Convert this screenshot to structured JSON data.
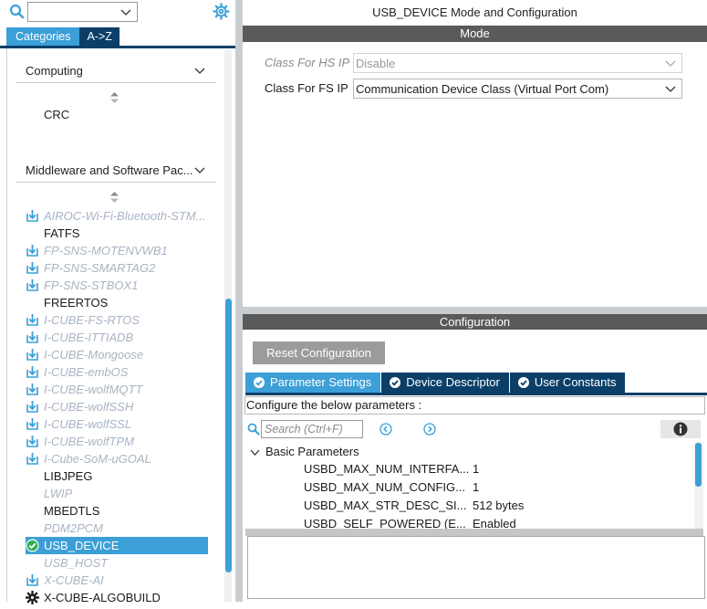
{
  "left": {
    "search_value": "",
    "tabs": [
      "Categories",
      "A->Z"
    ],
    "categories": [
      {
        "label": "Computing",
        "items": [
          "CRC"
        ]
      },
      {
        "label": "Middleware and Software Pac..."
      }
    ],
    "middleware_items": [
      {
        "label": "AIROC-Wi-Fi-Bluetooth-STM...",
        "state": "disabled",
        "icon": "download-icon"
      },
      {
        "label": "FATFS",
        "state": "normal",
        "icon": ""
      },
      {
        "label": "FP-SNS-MOTENVWB1",
        "state": "disabled",
        "icon": "download-icon"
      },
      {
        "label": "FP-SNS-SMARTAG2",
        "state": "disabled",
        "icon": "download-icon"
      },
      {
        "label": "FP-SNS-STBOX1",
        "state": "disabled",
        "icon": "download-icon"
      },
      {
        "label": "FREERTOS",
        "state": "normal",
        "icon": ""
      },
      {
        "label": "I-CUBE-FS-RTOS",
        "state": "disabled",
        "icon": "download-icon"
      },
      {
        "label": "I-CUBE-ITTIADB",
        "state": "disabled",
        "icon": "download-icon"
      },
      {
        "label": "I-CUBE-Mongoose",
        "state": "disabled",
        "icon": "download-icon"
      },
      {
        "label": "I-CUBE-embOS",
        "state": "disabled",
        "icon": "download-icon"
      },
      {
        "label": "I-CUBE-wolfMQTT",
        "state": "disabled",
        "icon": "download-icon"
      },
      {
        "label": "I-CUBE-wolfSSH",
        "state": "disabled",
        "icon": "download-icon"
      },
      {
        "label": "I-CUBE-wolfSSL",
        "state": "disabled",
        "icon": "download-icon"
      },
      {
        "label": "I-CUBE-wolfTPM",
        "state": "disabled",
        "icon": "download-icon"
      },
      {
        "label": "I-Cube-SoM-uGOAL",
        "state": "disabled",
        "icon": "download-icon"
      },
      {
        "label": "LIBJPEG",
        "state": "normal",
        "icon": ""
      },
      {
        "label": "LWIP",
        "state": "gray",
        "icon": ""
      },
      {
        "label": "MBEDTLS",
        "state": "normal",
        "icon": ""
      },
      {
        "label": "PDM2PCM",
        "state": "gray",
        "icon": ""
      },
      {
        "label": "USB_DEVICE",
        "state": "selected",
        "icon": "check-circle-icon"
      },
      {
        "label": "USB_HOST",
        "state": "gray",
        "icon": ""
      },
      {
        "label": "X-CUBE-AI",
        "state": "disabled",
        "icon": "download-icon"
      },
      {
        "label": "X-CUBE-ALGOBUILD",
        "state": "normal",
        "icon": "gear-icon"
      }
    ]
  },
  "right": {
    "title": "USB_DEVICE Mode and Configuration",
    "mode_header": "Mode",
    "mode_rows": [
      {
        "label": "Class For HS IP",
        "value": "Disable",
        "disabled": true
      },
      {
        "label": "Class For FS IP",
        "value": "Communication Device Class (Virtual Port Com)",
        "disabled": false
      }
    ],
    "config_header": "Configuration",
    "reset_label": "Reset Configuration",
    "config_tabs": [
      "Parameter Settings",
      "Device Descriptor",
      "User Constants"
    ],
    "configure_label": "Configure the below parameters :",
    "search_placeholder": "Search (Ctrl+F)",
    "group_label": "Basic Parameters",
    "params": [
      {
        "name": "USBD_MAX_NUM_INTERFA...",
        "value": "1"
      },
      {
        "name": "USBD_MAX_NUM_CONFIG...",
        "value": "1"
      },
      {
        "name": "USBD_MAX_STR_DESC_SI...",
        "value": "512 bytes"
      },
      {
        "name": "USBD_SELF_POWERED (E...",
        "value": "Enabled"
      }
    ]
  },
  "colors": {
    "accent": "#3c9fd7",
    "navy": "#0b3f68",
    "header_gray": "#5a5a5a",
    "disabled_text": "#a8b4c2"
  }
}
